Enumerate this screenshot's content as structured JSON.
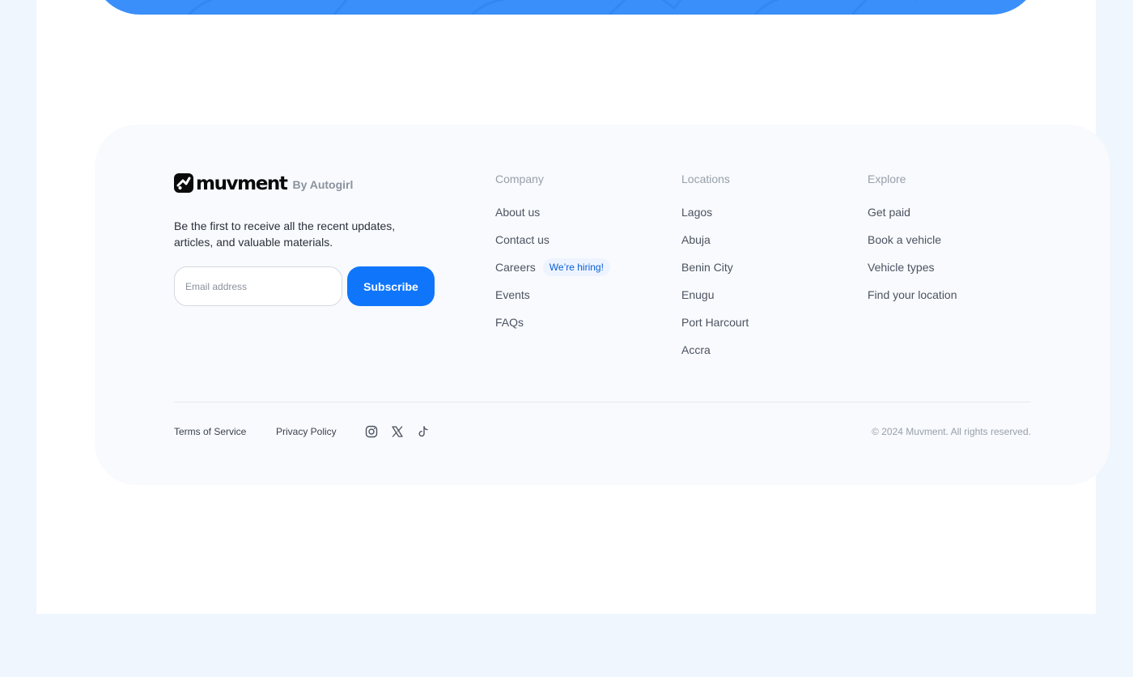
{
  "brand": {
    "name": "muvment",
    "byline": "By Autogirl",
    "logo_icon": "muvment-logo-icon"
  },
  "newsletter": {
    "tagline": "Be the first to receive all the recent updates, articles, and valuable materials.",
    "email_placeholder": "Email address",
    "subscribe_label": "Subscribe"
  },
  "columns": {
    "company": {
      "heading": "Company",
      "links": [
        "About us",
        "Contact us",
        "Careers",
        "Events",
        "FAQs"
      ],
      "badge": "We’re hiring!"
    },
    "locations": {
      "heading": "Locations",
      "links": [
        "Lagos",
        "Abuja",
        "Benin City",
        "Enugu",
        "Port Harcourt",
        "Accra"
      ]
    },
    "explore": {
      "heading": "Explore",
      "links": [
        "Get paid",
        "Book a vehicle",
        "Vehicle types",
        "Find your location"
      ]
    }
  },
  "legal": {
    "terms": "Terms of Service",
    "privacy": "Privacy Policy",
    "copyright": "© 2024 Muvment. All rights reserved."
  },
  "social": [
    "instagram-icon",
    "x-icon",
    "tiktok-icon"
  ],
  "colors": {
    "accent": "#0f76fb",
    "hero": "#3a8ffb",
    "page_bg": "#eff6fe",
    "card_bg": "#f8fafd",
    "badge_bg": "#edf4ff",
    "badge_text": "#0a5ed7"
  }
}
